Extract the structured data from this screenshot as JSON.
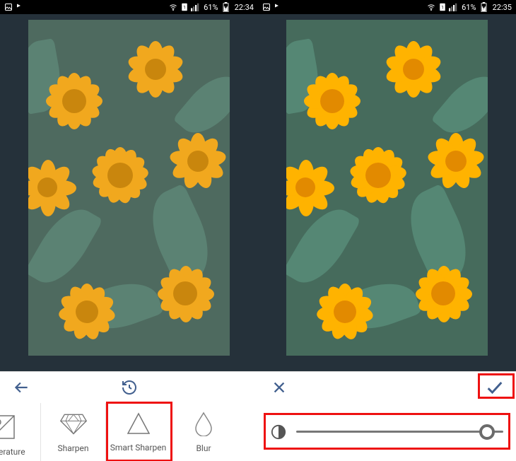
{
  "status": {
    "battery_pct": "61%"
  },
  "left": {
    "time": "22:34",
    "tools": {
      "temperature": "erature",
      "sharpen": "Sharpen",
      "smart_sharpen": "Smart Sharpen",
      "blur": "Blur"
    }
  },
  "right": {
    "time": "22:35",
    "slider": {
      "value_pct": 92
    }
  }
}
